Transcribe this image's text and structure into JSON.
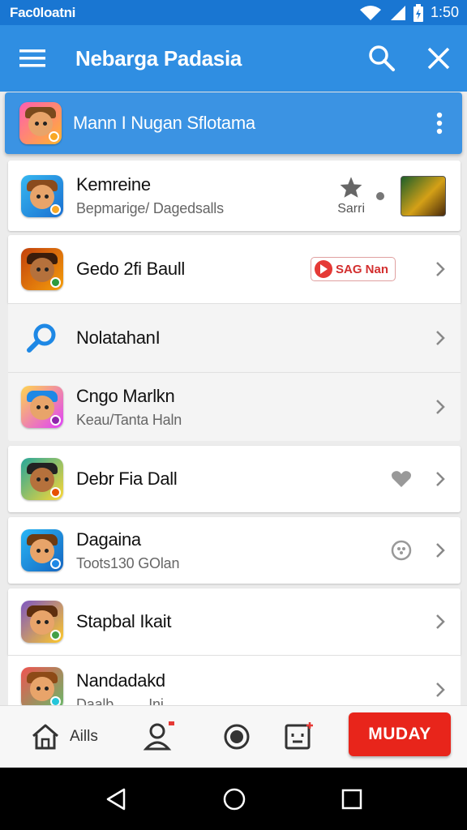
{
  "status_bar": {
    "carrier": "Fac0loatni",
    "time": "1:50"
  },
  "app_bar": {
    "title": "Nebarga Padasia"
  },
  "highlighted": {
    "label": "Mann I Nugan Sflotama"
  },
  "rows": [
    {
      "title": "Kemreine",
      "subtitle": "Bepmarige/ Dagedsalls",
      "rating_label": "Sarri"
    },
    {
      "title": "Gedo 2fi Baull",
      "tag": "SAG Nan"
    },
    {
      "title": "NolatahanI"
    },
    {
      "title": "Cngo Marlkn",
      "subtitle": "Keau/Tanta Haln"
    },
    {
      "title": "Debr Fia Dall"
    },
    {
      "title": "Dagaina",
      "subtitle": "Toots130 GOlan"
    },
    {
      "title": "Stapbal Ikait"
    },
    {
      "title": "Nandadakd",
      "subtitle": "Daalb         Ini"
    }
  ],
  "bottom_nav": {
    "home_label": "Aills",
    "cta_label": "MUDAY"
  },
  "colors": {
    "primary": "#2f8ee2",
    "status": "#1976d2",
    "cta": "#e8251b"
  }
}
